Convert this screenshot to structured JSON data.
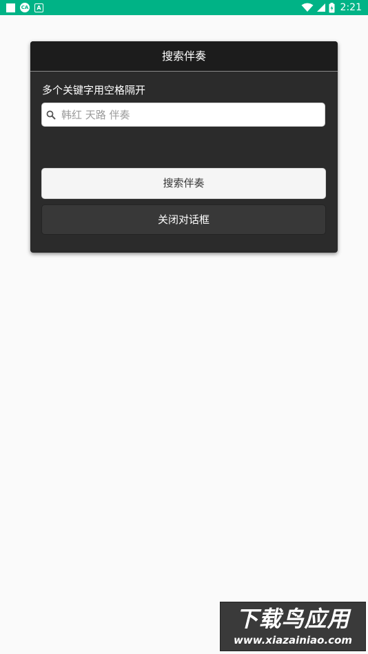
{
  "status_bar": {
    "time": "2:21",
    "app_icon_text": "CA",
    "a_icon_text": "A",
    "background": "#00b386"
  },
  "dialog": {
    "title": "搜索伴奏",
    "hint": "多个关键字用空格隔开",
    "search": {
      "value": "",
      "placeholder": "韩红 天路 伴奏"
    },
    "search_button_label": "搜索伴奏",
    "close_button_label": "关闭对话框"
  },
  "watermark": {
    "title": "下载鸟应用",
    "url": "www.xiazainiao.com"
  }
}
